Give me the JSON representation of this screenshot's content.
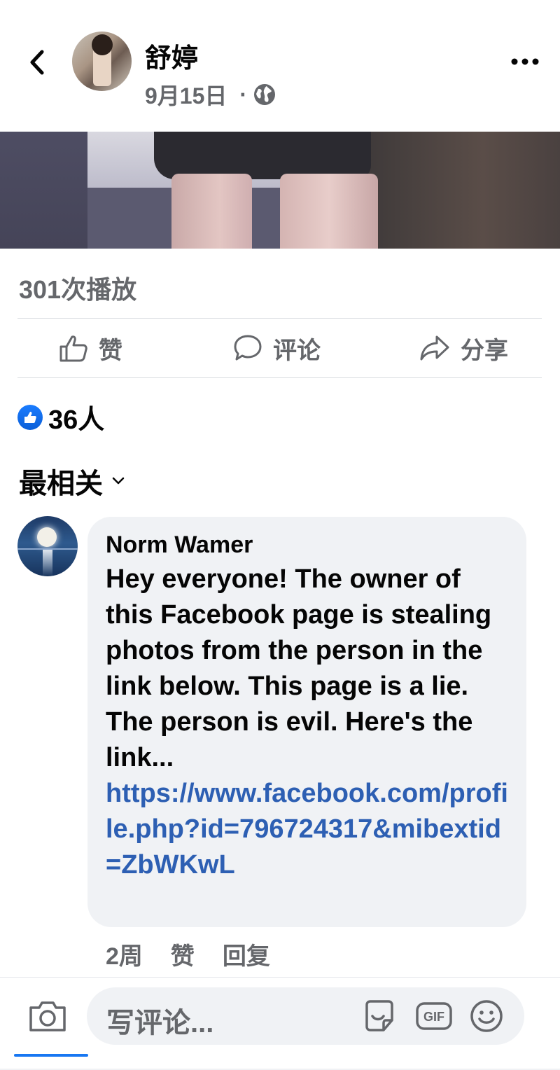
{
  "header": {
    "page_name": "舒婷",
    "date": "9月15日",
    "dot": "·",
    "icons": {
      "back": "chevron-left-icon",
      "privacy": "globe-icon",
      "more": "more-horizontal-icon"
    }
  },
  "video": {
    "views": "301次播放"
  },
  "actions": {
    "like_label": "赞",
    "comment_label": "评论",
    "share_label": "分享",
    "icons": {
      "like": "thumbs-up-icon",
      "comment": "speech-bubble-icon",
      "share": "share-arrow-icon"
    }
  },
  "reactions": {
    "count": "36人",
    "icon": "like-reaction-icon",
    "color": "#1877f2"
  },
  "comments": {
    "sort_label": "最相关",
    "items": [
      {
        "author": "Norm Wamer",
        "text": "Hey everyone!  The owner of this Facebook page is stealing photos from the person in the link below. This page is a lie. The person is evil. Here's the link...",
        "link": "https://www.facebook.com/profile.php?id=796724317&mibextid=ZbWKwL",
        "time": "2周",
        "like_label": "赞",
        "reply_label": "回复"
      }
    ]
  },
  "composer": {
    "placeholder": "写评论...",
    "icons": {
      "camera": "camera-icon",
      "sticker": "sticker-icon",
      "gif": "gif-icon",
      "emoji": "emoji-icon"
    },
    "gif_label": "GIF"
  },
  "colors": {
    "link": "#2d5fb3",
    "secondary_text": "#65676b",
    "bubble": "#f0f2f5",
    "accent": "#1877f2"
  }
}
